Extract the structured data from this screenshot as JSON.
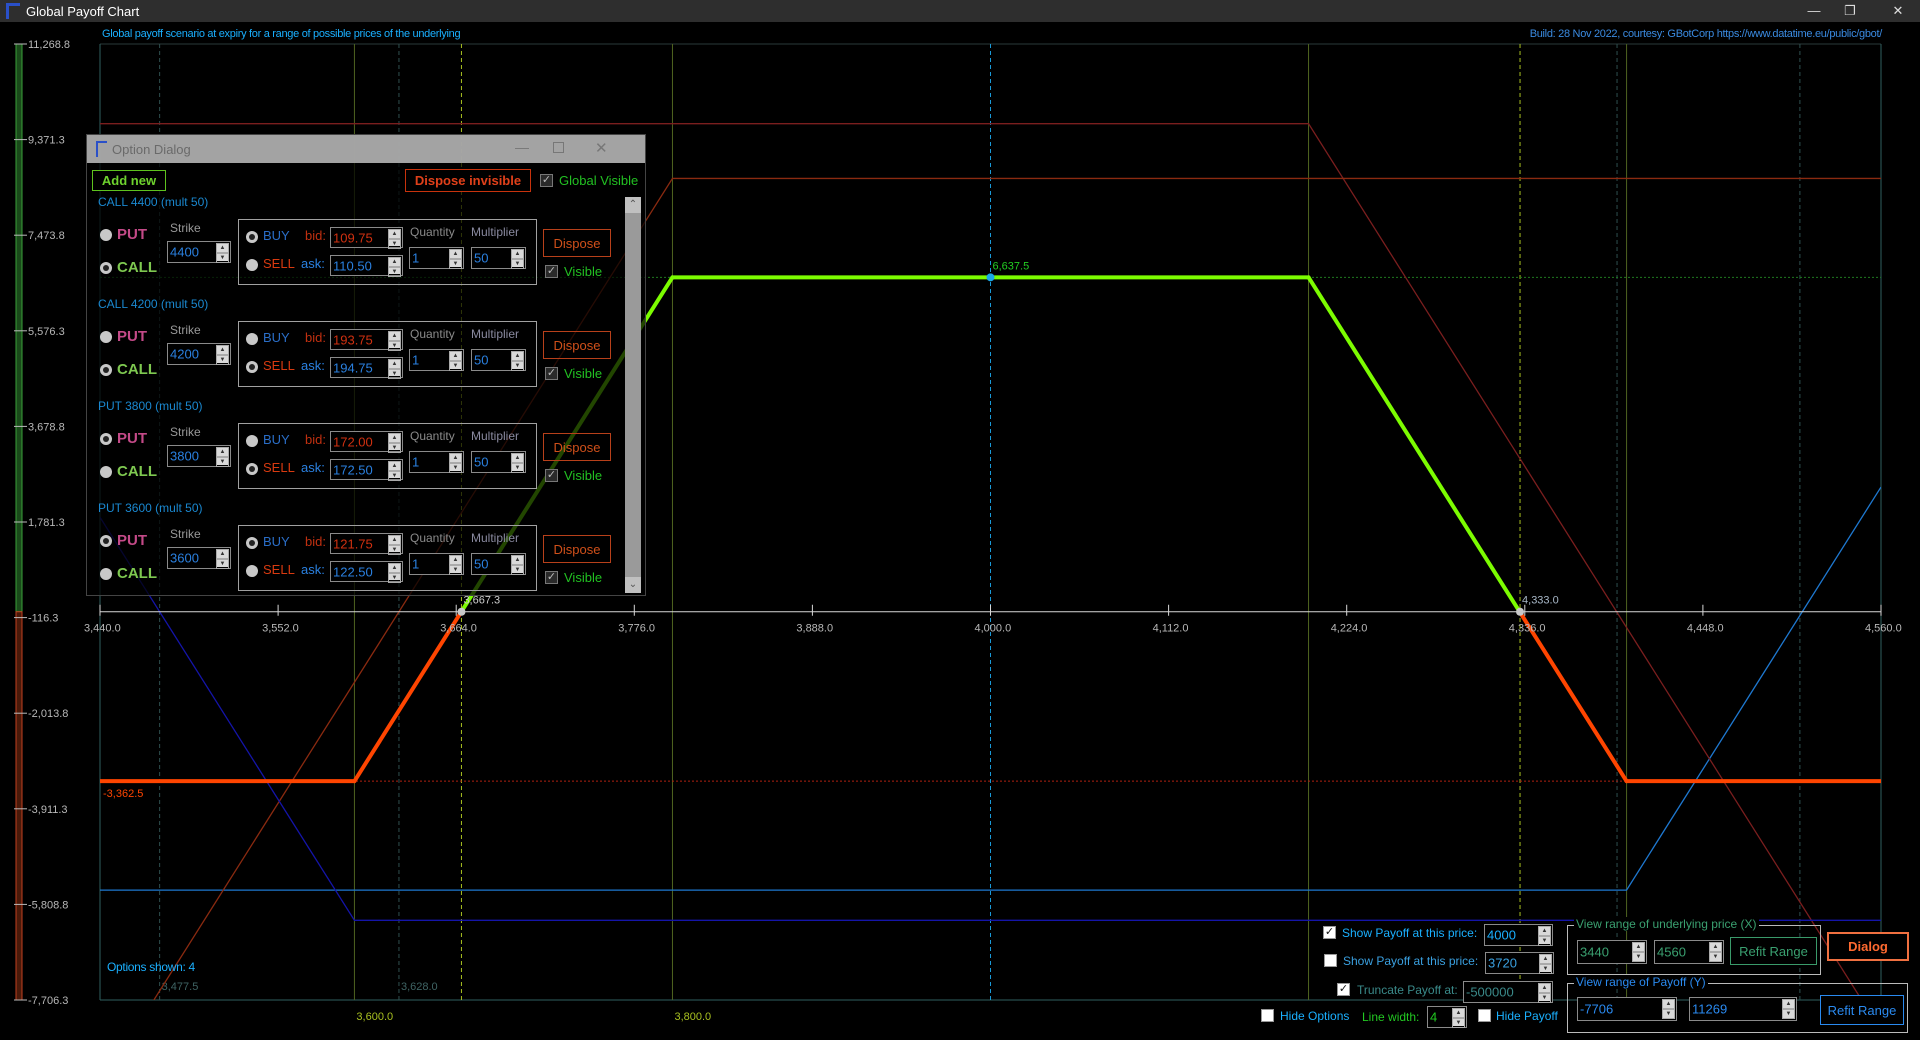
{
  "window": {
    "title": "Global Payoff Chart",
    "controls": [
      "minimize-icon",
      "restore-icon",
      "close-icon"
    ]
  },
  "chart_header": {
    "subtitle": "Global payoff scenario at expiry for a range of possible prices of the underlying",
    "build": "Build: 28 Nov 2022, courtesy: GBotCorp https://www.datatime.eu/public/gbot/"
  },
  "options_shown": "Options shown: 4",
  "chart_data": {
    "type": "line",
    "title": "Global payoff scenario at expiry for a range of possible prices of the underlying",
    "xlim": [
      3440,
      4560
    ],
    "ylim": [
      -7706.3,
      11268.8
    ],
    "grid": false,
    "x_ticks": [
      3440,
      3552,
      3664,
      3776,
      3888,
      4000,
      4112,
      4224,
      4336,
      4448,
      4560
    ],
    "x_tick_labels": [
      "3,440.0",
      "3,552.0",
      "3,664.0",
      "3,776.0",
      "3,888.0",
      "4,000.0",
      "4,112.0",
      "4,224.0",
      "4,336.0",
      "4,448.0",
      "4,560.0"
    ],
    "y_ticks": [
      11268.8,
      9371.3,
      7473.8,
      5576.3,
      3678.8,
      1781.3,
      -116.3,
      -2013.8,
      -3911.3,
      -5808.8,
      -7706.3
    ],
    "y_tick_labels": [
      "11,268.8",
      "9,371.3",
      "7,473.8",
      "5,576.3",
      "3,678.8",
      "1,781.3",
      "-116.3",
      "-2,013.8",
      "-3,911.3",
      "-5,808.8",
      "-7,706.3"
    ],
    "axis_colors": {
      "positive": "#2e8b2e",
      "negative": "#b03a1a"
    },
    "total_payoff": {
      "points": [
        [
          3440,
          -3362.5
        ],
        [
          3600,
          -3362.5
        ],
        [
          3800,
          6637.5
        ],
        [
          4200,
          6637.5
        ],
        [
          4400,
          -3362.5
        ],
        [
          4560,
          -3362.5
        ]
      ],
      "positive_color": "#7cfc00",
      "negative_color": "#ff4500",
      "line_width": 4,
      "max": 6637.5,
      "min": -3362.5
    },
    "legs": [
      {
        "option": 0,
        "color": "#1e78d0",
        "points": [
          [
            3440,
            -5525
          ],
          [
            4400,
            -5525
          ],
          [
            4560,
            2475
          ]
        ]
      },
      {
        "option": 1,
        "color": "#7a1e1e",
        "points": [
          [
            3440,
            9687.5
          ],
          [
            4200,
            9687.5
          ],
          [
            4560,
            -8312.5
          ]
        ]
      },
      {
        "option": 2,
        "color": "#8a2a10",
        "points": [
          [
            3440,
            -9400
          ],
          [
            3800,
            8600
          ],
          [
            4560,
            8600
          ]
        ]
      },
      {
        "option": 3,
        "color": "#1414a8",
        "points": [
          [
            3440,
            1875
          ],
          [
            3600,
            -6125
          ],
          [
            4560,
            -6125
          ]
        ]
      }
    ],
    "vertical_markers": [
      {
        "x": 3600,
        "style": "solid",
        "color": "#4f6420",
        "label": "3,600.0"
      },
      {
        "x": 3800,
        "style": "solid",
        "color": "#4f6420",
        "label": "3,800.0"
      },
      {
        "x": 4200,
        "style": "solid",
        "color": "#4f6420"
      },
      {
        "x": 4400,
        "style": "solid",
        "color": "#4f6420"
      },
      {
        "x": 3477.5,
        "style": "dashed",
        "color": "#2f4f4f",
        "label": "3,477.5"
      },
      {
        "x": 3628.0,
        "style": "dashed",
        "color": "#2f4f4f",
        "label": "3,628.0"
      },
      {
        "x": 4394,
        "style": "dashed",
        "color": "#2f4f4f"
      },
      {
        "x": 4509,
        "style": "dashed",
        "color": "#2f4f4f"
      },
      {
        "x": 3667.3,
        "style": "dashed",
        "color": "#a8c020"
      },
      {
        "x": 4333.0,
        "style": "dashed",
        "color": "#a8c020"
      },
      {
        "x": 4000,
        "style": "dashed",
        "color": "#1a9ad8"
      }
    ],
    "annotations": [
      {
        "x": 3667.3,
        "y": 0,
        "label": "3,667.3",
        "color": "#cfcfcf",
        "dot": "#c8c8c8"
      },
      {
        "x": 4333.0,
        "y": 0,
        "label": "4,333.0",
        "color": "#a8b8c8",
        "dot": "#c8c8c8"
      },
      {
        "x": 4000,
        "y": 6637.5,
        "label": "6,637.5",
        "color": "#22cc22",
        "dot": "#1aa8e8"
      },
      {
        "x": 3440,
        "y": -3362.5,
        "label": "-3,362.5",
        "color": "#ff4500"
      }
    ]
  },
  "dialog": {
    "title": "Option Dialog",
    "add_new": "Add new",
    "dispose_invisible": "Dispose invisible",
    "global_visible": {
      "label": "Global Visible",
      "checked": true
    },
    "labels": {
      "put": "PUT",
      "call": "CALL",
      "strike": "Strike",
      "buy": "BUY",
      "sell": "SELL",
      "bid": "bid:",
      "ask": "ask:",
      "quantity": "Quantity",
      "multiplier": "Multiplier",
      "dispose": "Dispose",
      "visible": "Visible"
    },
    "options": [
      {
        "header": "CALL 4400 (mult 50)",
        "type": "CALL",
        "strike": "4400",
        "side": "BUY",
        "bid": "109.75",
        "ask": "110.50",
        "quantity": "1",
        "multiplier": "50",
        "visible": true
      },
      {
        "header": "CALL 4200 (mult 50)",
        "type": "CALL",
        "strike": "4200",
        "side": "SELL",
        "bid": "193.75",
        "ask": "194.75",
        "quantity": "1",
        "multiplier": "50",
        "visible": true
      },
      {
        "header": "PUT 3800 (mult 50)",
        "type": "PUT",
        "strike": "3800",
        "side": "SELL",
        "bid": "172.00",
        "ask": "172.50",
        "quantity": "1",
        "multiplier": "50",
        "visible": true
      },
      {
        "header": "PUT 3600 (mult 50)",
        "type": "PUT",
        "strike": "3600",
        "side": "BUY",
        "bid": "121.75",
        "ask": "122.50",
        "quantity": "1",
        "multiplier": "50",
        "visible": true
      }
    ]
  },
  "controls": {
    "show_payoff_1": {
      "label": "Show Payoff at this price:",
      "checked": true,
      "value": "4000"
    },
    "show_payoff_2": {
      "label": "Show Payoff at this price:",
      "checked": false,
      "value": "3720"
    },
    "truncate": {
      "label": "Truncate Payoff at:",
      "checked": true,
      "value": "-500000"
    },
    "hide_options": {
      "label": "Hide Options",
      "checked": false
    },
    "line_width": {
      "label": "Line width:",
      "value": "4"
    },
    "hide_payoff": {
      "label": "Hide Payoff",
      "checked": false
    },
    "x_range": {
      "legend": "View range of underlying price (X)",
      "min": "3440",
      "max": "4560",
      "refit": "Refit Range"
    },
    "y_range": {
      "legend": "View range of Payoff (Y)",
      "min": "-7706",
      "max": "11269",
      "refit": "Refit Range"
    },
    "dialog_button": "Dialog"
  }
}
